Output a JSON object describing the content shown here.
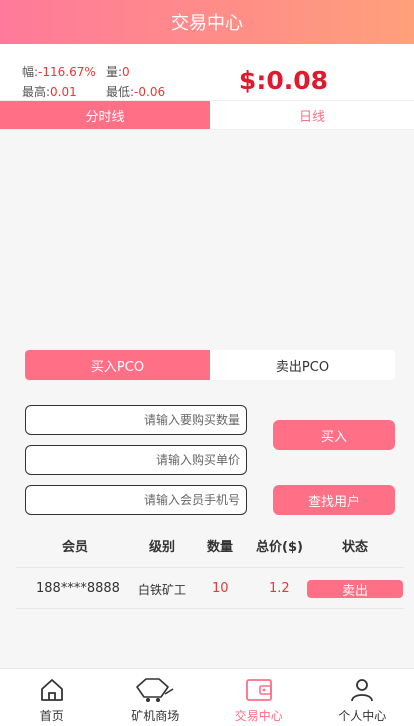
{
  "header": {
    "title": "交易中心"
  },
  "stats": {
    "change_label": "幅:",
    "change_value": "-116.67%",
    "volume_label": "量:",
    "volume_value": "0",
    "high_label": "最高:",
    "high_value": "0.01",
    "low_label": "最低:",
    "low_value": "-0.06",
    "price": "$:0.08"
  },
  "chart_tabs": [
    {
      "label": "分时线",
      "active": true
    },
    {
      "label": "日线",
      "active": false
    }
  ],
  "trade_tabs": [
    {
      "label": "买入PCO",
      "active": true
    },
    {
      "label": "卖出PCO",
      "active": false
    }
  ],
  "form": {
    "quantity_placeholder": "请输入要购买数量",
    "unit_price_placeholder": "请输入购买单价",
    "phone_placeholder": "请输入会员手机号",
    "buy_label": "买入",
    "find_user_label": "查找用户"
  },
  "table": {
    "headers": [
      "会员",
      "级别",
      "数量",
      "总价($)",
      "状态"
    ],
    "rows": [
      {
        "member": "188****8888",
        "level": "白铁矿工",
        "quantity": "10",
        "total": "1.2",
        "action": "卖出"
      }
    ]
  },
  "nav": [
    {
      "label": "首页",
      "icon": "home-icon",
      "active": false
    },
    {
      "label": "矿机商场",
      "icon": "mining-cart-icon",
      "active": false
    },
    {
      "label": "交易中心",
      "icon": "wallet-icon",
      "active": true
    },
    {
      "label": "个人中心",
      "icon": "user-icon",
      "active": false
    }
  ],
  "colors": {
    "accent": "#ff6f86",
    "price": "#e0192c",
    "value_red": "#e53935"
  }
}
